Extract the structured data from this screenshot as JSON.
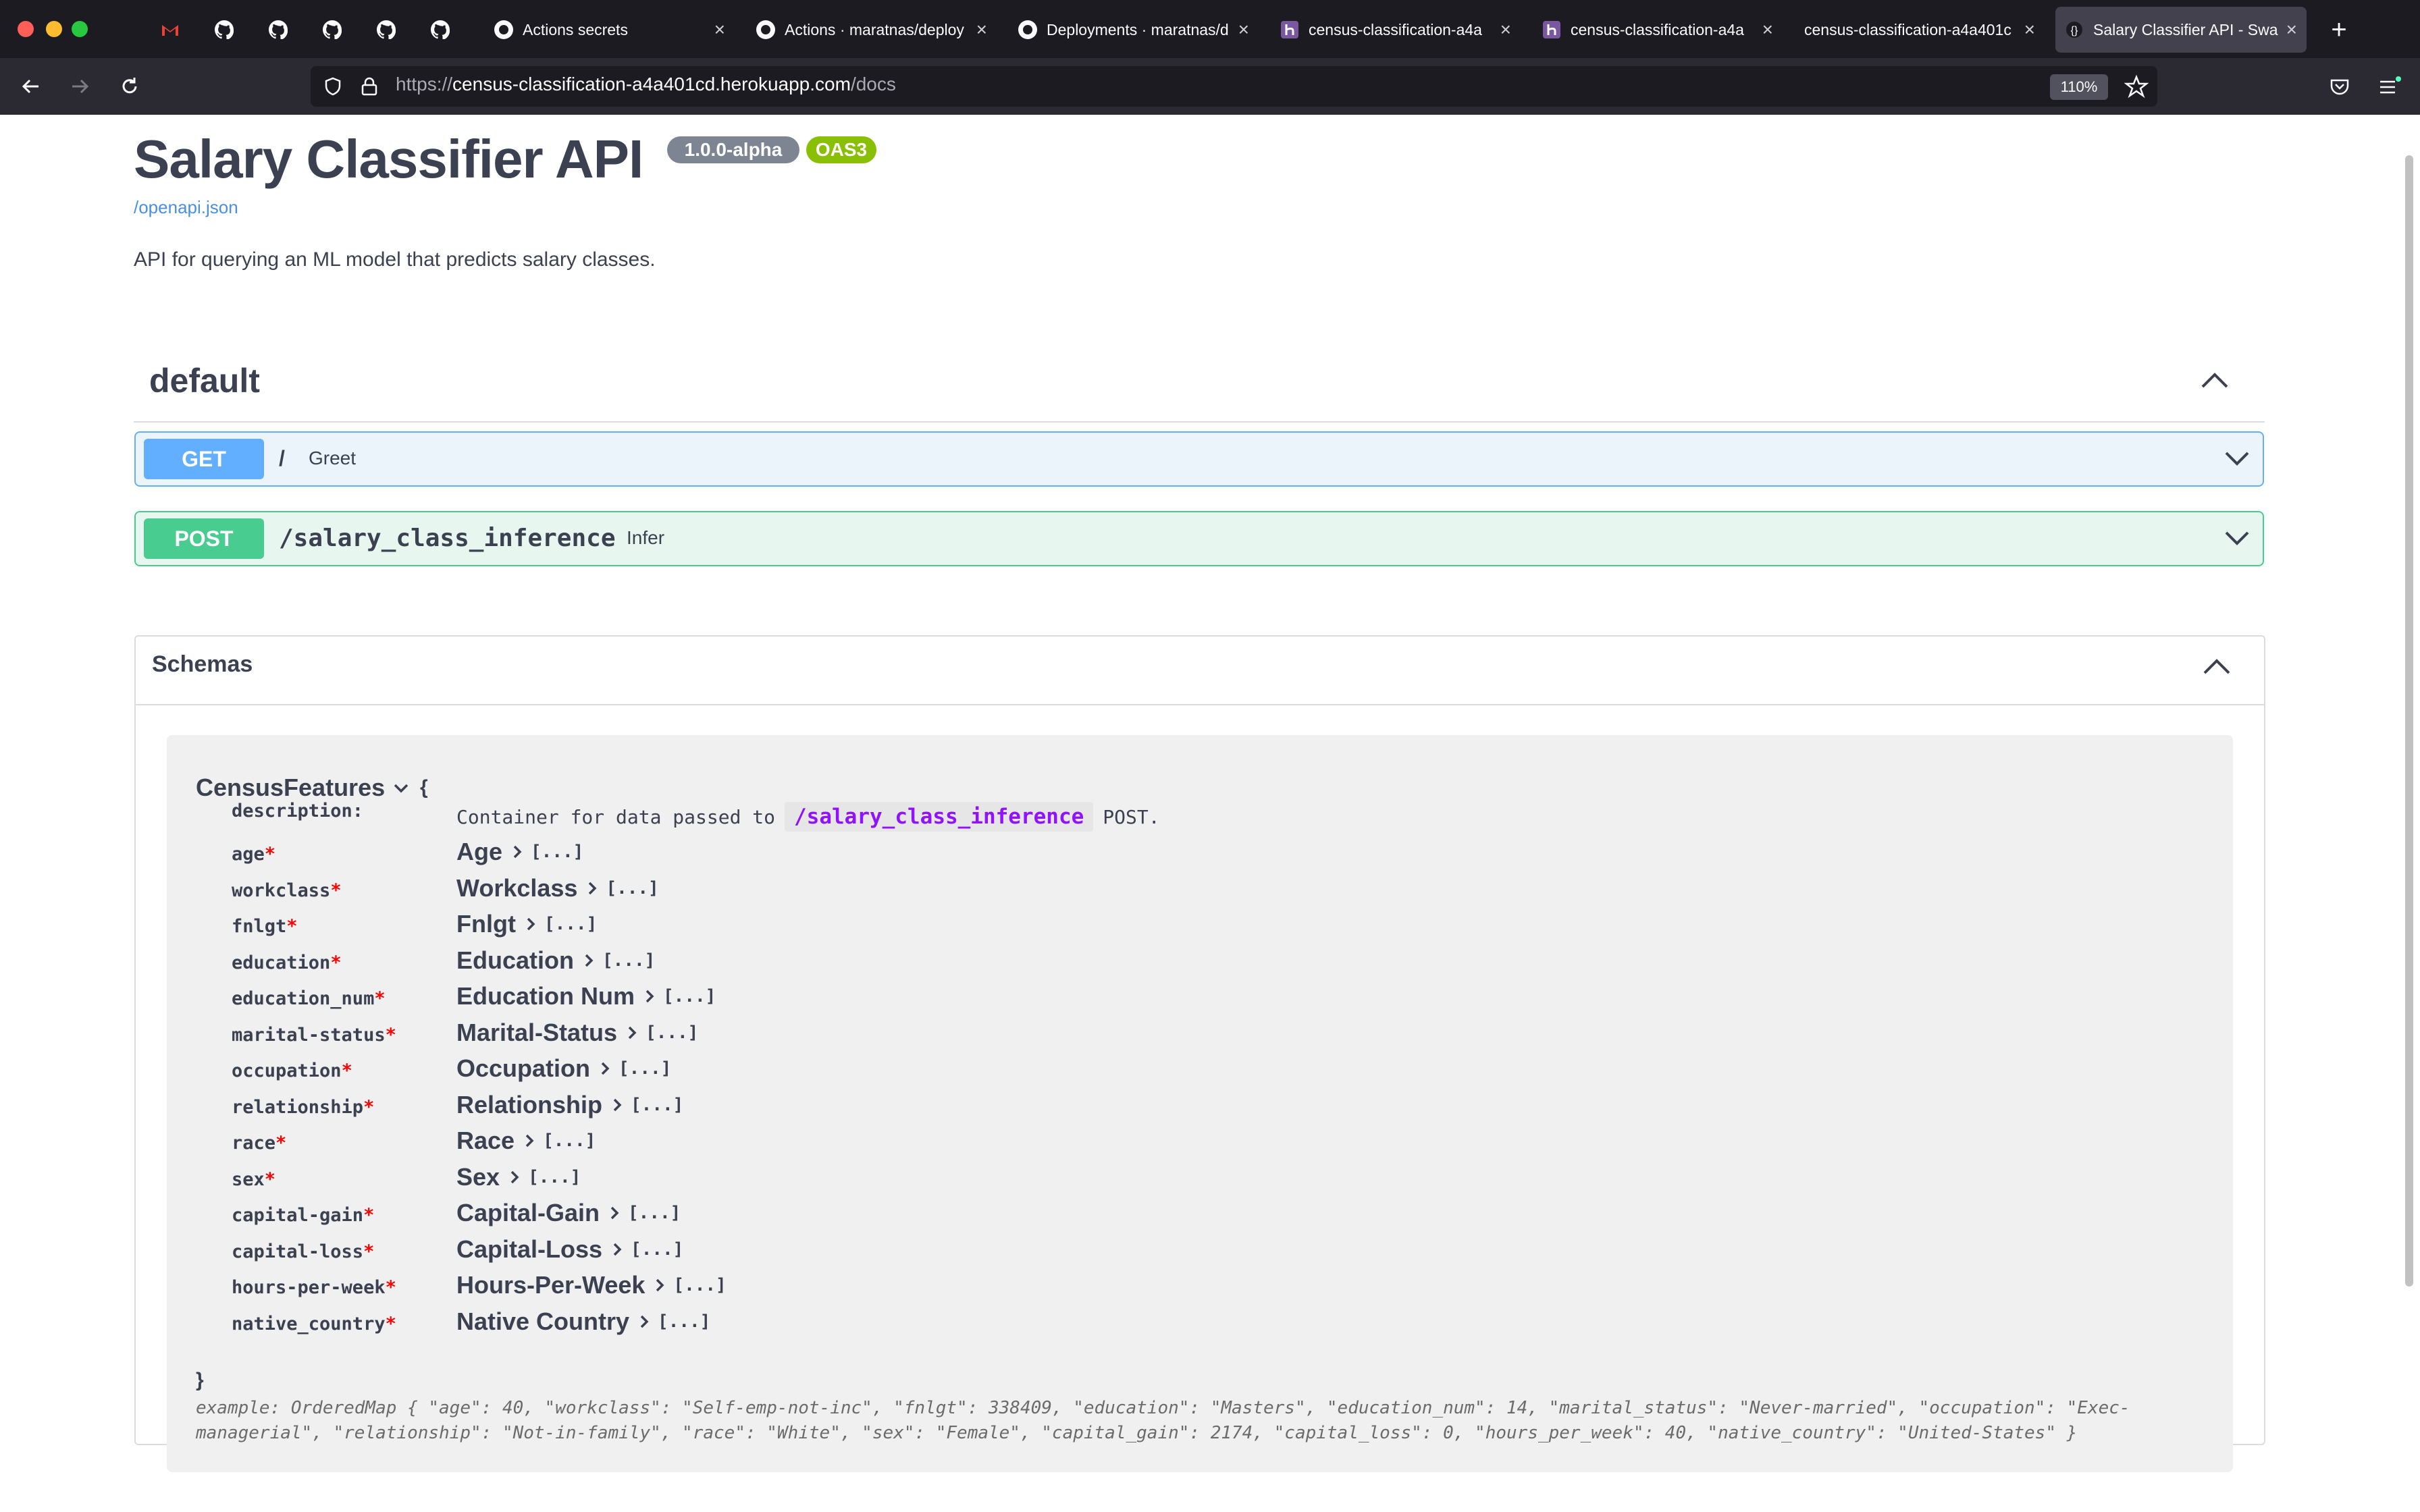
{
  "browser": {
    "tabs": [
      {
        "title": "",
        "icon": "gmail-icon"
      },
      {
        "title": "",
        "icon": "github-icon"
      },
      {
        "title": "",
        "icon": "github-icon"
      },
      {
        "title": "",
        "icon": "github-icon"
      },
      {
        "title": "",
        "icon": "github-icon"
      },
      {
        "title": "",
        "icon": "github-icon"
      },
      {
        "title": "Actions secrets",
        "icon": "github-icon"
      },
      {
        "title": "Actions · maratnas/deploy",
        "icon": "github-icon"
      },
      {
        "title": "Deployments · maratnas/d",
        "icon": "github-icon"
      },
      {
        "title": "census-classification-a4a",
        "icon": "heroku-icon"
      },
      {
        "title": "census-classification-a4a",
        "icon": "heroku-icon"
      },
      {
        "title": "census-classification-a4a401c",
        "icon": ""
      },
      {
        "title": "Salary Classifier API - Swa",
        "icon": "swagger-icon",
        "active": true
      }
    ],
    "url_prefix": "https://",
    "url_host": "census-classification-a4a401cd.herokuapp.com",
    "url_path": "/docs",
    "zoom": "110%"
  },
  "api": {
    "title": "Salary Classifier API",
    "version": "1.0.0-alpha",
    "oas": "OAS3",
    "openapi_link": "/openapi.json",
    "description": "API for querying an ML model that predicts salary classes."
  },
  "default_section": {
    "title": "default",
    "operations": [
      {
        "method": "GET",
        "path": "/",
        "summary": "Greet"
      },
      {
        "method": "POST",
        "path": "/salary_class_inference",
        "summary": "Infer"
      }
    ]
  },
  "schemas": {
    "title": "Schemas",
    "model": {
      "name": "CensusFeatures",
      "open_brace": "{",
      "close_brace": "}",
      "description_label": "description:",
      "description_pre": "Container for data passed to",
      "description_code": "/salary_class_inference",
      "description_post": "POST.",
      "properties": [
        {
          "name": "age",
          "type": "Age"
        },
        {
          "name": "workclass",
          "type": "Workclass"
        },
        {
          "name": "fnlgt",
          "type": "Fnlgt"
        },
        {
          "name": "education",
          "type": "Education"
        },
        {
          "name": "education_num",
          "type": "Education Num"
        },
        {
          "name": "marital-status",
          "type": "Marital-Status"
        },
        {
          "name": "occupation",
          "type": "Occupation"
        },
        {
          "name": "relationship",
          "type": "Relationship"
        },
        {
          "name": "race",
          "type": "Race"
        },
        {
          "name": "sex",
          "type": "Sex"
        },
        {
          "name": "capital-gain",
          "type": "Capital-Gain"
        },
        {
          "name": "capital-loss",
          "type": "Capital-Loss"
        },
        {
          "name": "hours-per-week",
          "type": "Hours-Per-Week"
        },
        {
          "name": "native_country",
          "type": "Native Country"
        }
      ],
      "required_mark": "*",
      "expand_text": "[...]",
      "example": "example: OrderedMap { \"age\": 40, \"workclass\": \"Self-emp-not-inc\", \"fnlgt\": 338409, \"education\": \"Masters\", \"education_num\": 14, \"marital_status\": \"Never-married\", \"occupation\": \"Exec-managerial\", \"relationship\": \"Not-in-family\", \"race\": \"White\", \"sex\": \"Female\", \"capital_gain\": 2174, \"capital_loss\": 0, \"hours_per_week\": 40, \"native_country\": \"United-States\" }"
    }
  },
  "colors": {
    "get": "#61affe",
    "post": "#49cc90",
    "version_badge": "#89bf04",
    "oas_badge": "#89bf04",
    "version_badge_bg": "#7d8492",
    "text": "#3b4151"
  }
}
